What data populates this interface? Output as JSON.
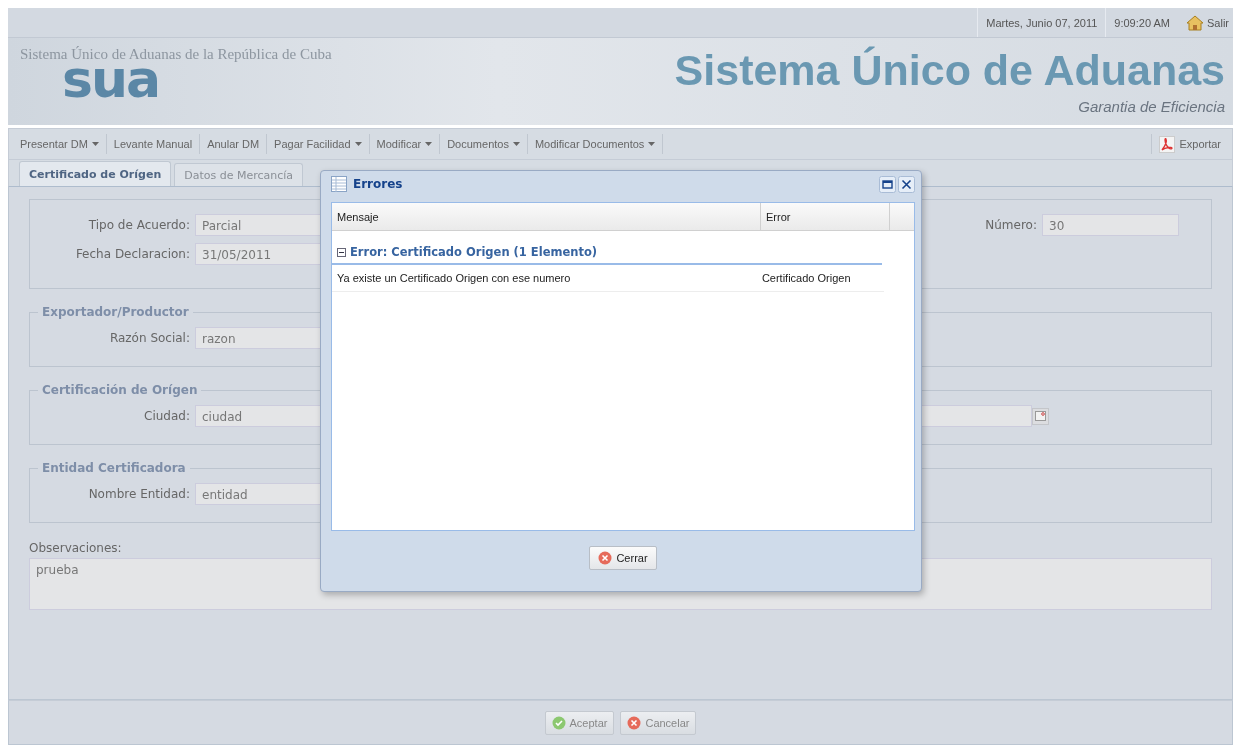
{
  "top_bar": {
    "date": "Martes, Junio 07, 2011",
    "time": "9:09:20 AM",
    "logout": "Salir"
  },
  "banner": {
    "caption": "Sistema Único de Aduanas de la República de Cuba",
    "logo": "sua",
    "title": "Sistema Único de Aduanas",
    "slogan": "Garantia de Eficiencia"
  },
  "toolbar": {
    "items": [
      {
        "label": "Presentar DM",
        "has_menu": true
      },
      {
        "label": "Levante Manual",
        "has_menu": false
      },
      {
        "label": "Anular DM",
        "has_menu": false
      },
      {
        "label": "Pagar Facilidad",
        "has_menu": true
      },
      {
        "label": "Modificar",
        "has_menu": true
      },
      {
        "label": "Documentos",
        "has_menu": true
      },
      {
        "label": "Modificar Documentos",
        "has_menu": true
      }
    ],
    "export": "Exportar"
  },
  "tabs": [
    {
      "label": "Certificado de Orígen",
      "selected": true
    },
    {
      "label": "Datos de Mercancía",
      "selected": false
    }
  ],
  "form": {
    "sections": [
      {
        "left_fields": [
          {
            "kind": "text",
            "label": "Tipo de Acuerdo:",
            "value": "Parcial"
          },
          {
            "kind": "text",
            "label": "Fecha Declaracion:",
            "value": "31/05/2011"
          }
        ],
        "right_fields": [
          {
            "kind": "text",
            "label": "Número:",
            "value": "30"
          }
        ]
      },
      {
        "legend": "Exportador/Productor",
        "left_fields": [
          {
            "kind": "text",
            "label": "Razón Social:",
            "value": "razon"
          }
        ]
      },
      {
        "legend": "Certificación de Orígen",
        "left_fields": [
          {
            "kind": "text",
            "label": "Ciudad:",
            "value": "ciudad"
          }
        ],
        "right_fields": [
          {
            "kind": "date"
          }
        ]
      },
      {
        "legend": "Entidad Certificadora",
        "left_fields": [
          {
            "kind": "text",
            "label": "Nombre Entidad:",
            "value": "entidad"
          }
        ]
      }
    ],
    "observations": {
      "label": "Observaciones:",
      "value": "prueba"
    }
  },
  "footer_buttons": [
    {
      "kind": "ok",
      "label": "Aceptar"
    },
    {
      "kind": "cancel",
      "label": "Cancelar"
    }
  ],
  "dialog": {
    "title": "Errores",
    "columns": [
      "Mensaje",
      "Error"
    ],
    "groups": [
      {
        "title": "Error: Certificado Origen (1 Elemento)",
        "expanded": true,
        "rows": [
          {
            "message": "Ya existe un Certificado Origen con ese numero",
            "error": "Certificado Origen"
          }
        ]
      }
    ],
    "close_button": "Cerrar"
  }
}
